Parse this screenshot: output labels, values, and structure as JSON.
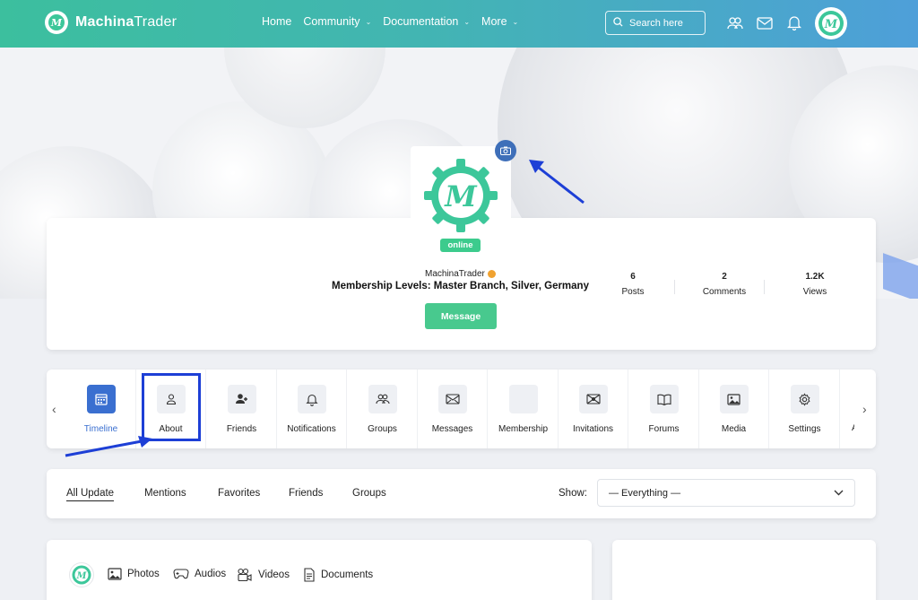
{
  "brand": {
    "name_bold": "Machina",
    "name_light": "Trader"
  },
  "nav": [
    {
      "label": "Home",
      "caret": false
    },
    {
      "label": "Community",
      "caret": true
    },
    {
      "label": "Documentation",
      "caret": true
    },
    {
      "label": "More",
      "caret": true
    }
  ],
  "search": {
    "placeholder": "Search here"
  },
  "profile": {
    "username": "MachinaTrader",
    "status": "online",
    "membership": "Membership Levels: Master Branch, Silver, Germany",
    "message_button": "Message",
    "stats": [
      {
        "value": "6",
        "label": "Posts"
      },
      {
        "value": "2",
        "label": "Comments"
      },
      {
        "value": "1.2K",
        "label": "Views"
      }
    ]
  },
  "tabs": [
    {
      "label": "Timeline",
      "icon": "calendar-icon",
      "active": true
    },
    {
      "label": "About",
      "icon": "person-icon",
      "active": false
    },
    {
      "label": "Friends",
      "icon": "add-friend-icon",
      "active": false
    },
    {
      "label": "Notifications",
      "icon": "bell-icon",
      "active": false
    },
    {
      "label": "Groups",
      "icon": "groups-icon",
      "active": false
    },
    {
      "label": "Messages",
      "icon": "envelope-icon",
      "active": false
    },
    {
      "label": "Membership",
      "icon": "membership-icon",
      "active": false
    },
    {
      "label": "Invitations",
      "icon": "invitation-icon",
      "active": false
    },
    {
      "label": "Forums",
      "icon": "book-icon",
      "active": false
    },
    {
      "label": "Media",
      "icon": "image-icon",
      "active": false
    },
    {
      "label": "Settings",
      "icon": "gear-icon",
      "active": false
    }
  ],
  "tabs_partial_label": "A",
  "activity_filters": [
    "All Update",
    "Mentions",
    "Favorites",
    "Friends",
    "Groups"
  ],
  "show": {
    "label": "Show:",
    "selected": "— Everything —"
  },
  "composer": {
    "items": [
      "Photos",
      "Audios",
      "Videos",
      "Documents"
    ]
  },
  "colors": {
    "brand_green": "#3ccb8d",
    "accent_blue": "#3a6fd0",
    "annotation_blue": "#1d3fd6"
  }
}
